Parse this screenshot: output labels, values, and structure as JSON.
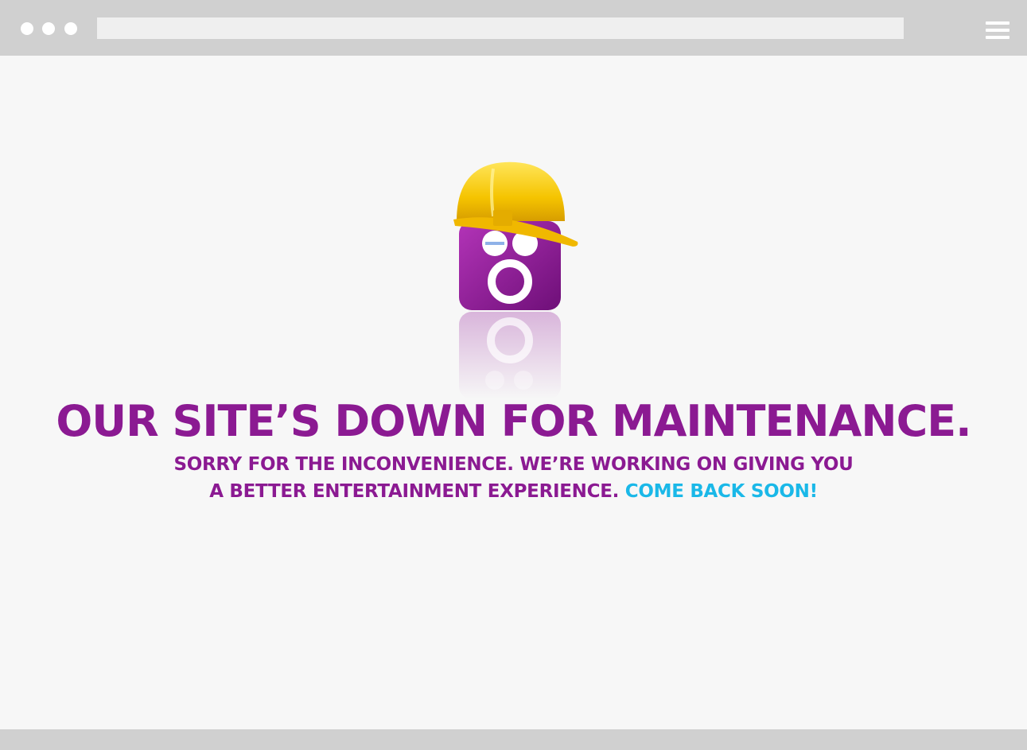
{
  "browser": {
    "dots": [
      "window-dot",
      "window-dot",
      "window-dot"
    ],
    "address_bar_value": "",
    "menu_icon": "hamburger-menu-icon"
  },
  "maintenance": {
    "headline": "OUR SITE’S DOWN FOR MAINTENANCE.",
    "line1": "SORRY FOR THE INCONVENIENCE. WE’RE WORKING ON GIVING YOU",
    "line2_main": "A BETTER ENTERTAINMENT EXPERIENCE.",
    "line2_accent": "COME BACK SOON!"
  },
  "colors": {
    "chrome": "#d0d0d0",
    "background": "#f7f7f7",
    "brand_purple": "#8b1a92",
    "accent_cyan": "#1ab8e8",
    "helmet_yellow": "#f5c400"
  },
  "icons": {
    "mascot": "hard-hat-mascot-icon"
  }
}
